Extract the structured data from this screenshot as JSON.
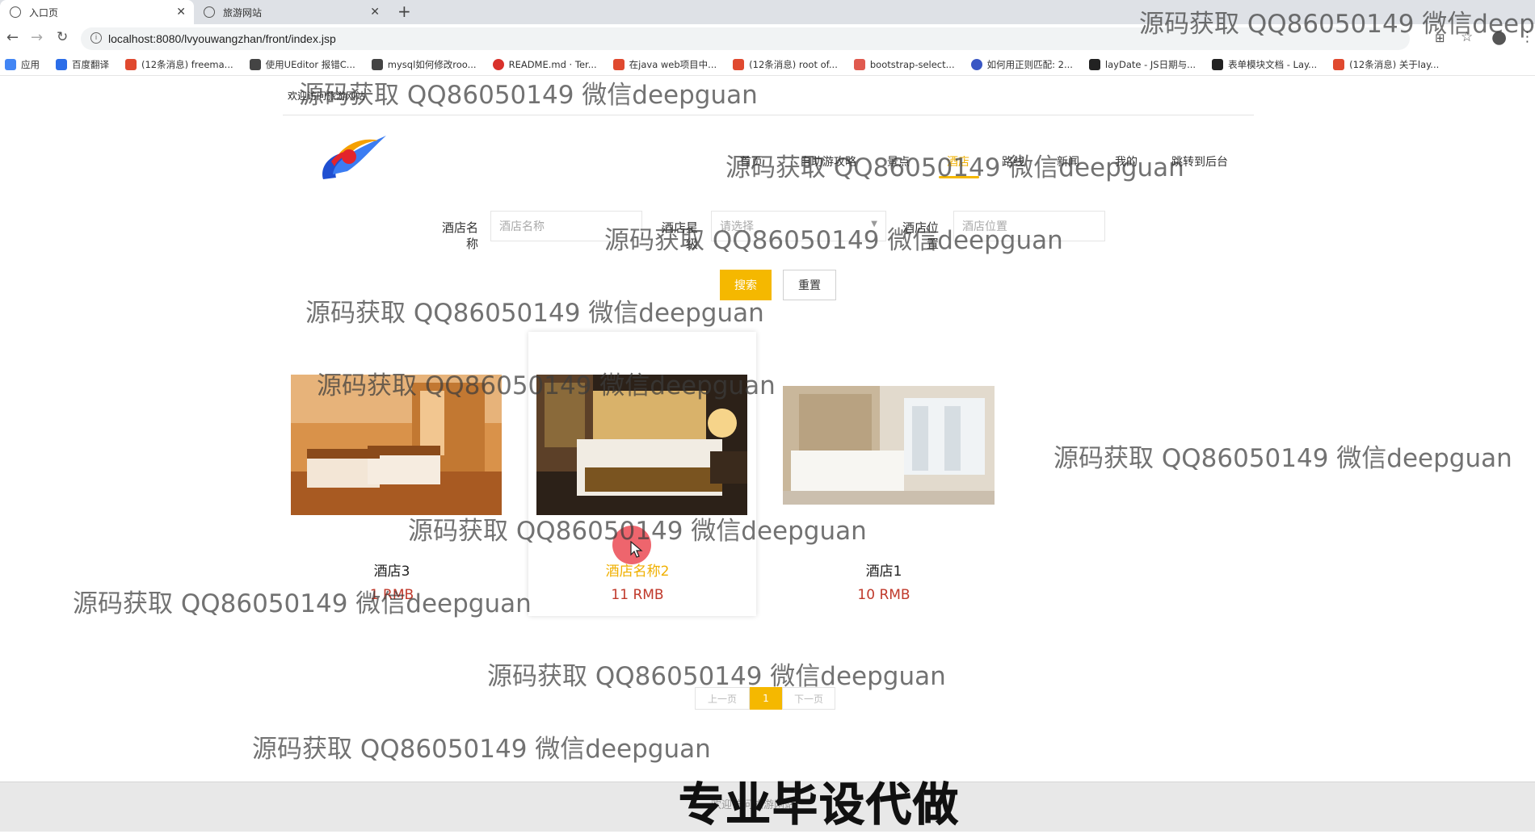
{
  "browser": {
    "tabs": [
      {
        "title": "入口页",
        "active": true
      },
      {
        "title": "旅游网站",
        "active": false
      }
    ],
    "url": "localhost:8080/lvyouwangzhan/front/index.jsp",
    "bookmarks": [
      {
        "label": "应用",
        "color": "#4285f4"
      },
      {
        "label": "百度翻译",
        "color": "#2b6de8"
      },
      {
        "label": "(12条消息) freema...",
        "color": "#e0492f"
      },
      {
        "label": "使用UEditor 报错C...",
        "color": "#444444"
      },
      {
        "label": "mysql如何修改roo...",
        "color": "#444444"
      },
      {
        "label": "README.md · Ter...",
        "color": "#d9312b"
      },
      {
        "label": "在java web项目中...",
        "color": "#e0492f"
      },
      {
        "label": "(12条消息) root of...",
        "color": "#e0492f"
      },
      {
        "label": "bootstrap-select...",
        "color": "#e05a4f"
      },
      {
        "label": "如何用正则匹配: 2...",
        "color": "#3a57c4"
      },
      {
        "label": "layDate - JS日期与...",
        "color": "#222222"
      },
      {
        "label": "表单模块文档 - Lay...",
        "color": "#222222"
      },
      {
        "label": "(12条消息) 关于lay...",
        "color": "#e0492f"
      }
    ]
  },
  "header": {
    "welcome": "欢迎访问旅游网站",
    "nav": [
      {
        "label": "首页",
        "active": false
      },
      {
        "label": "自助游攻略",
        "active": false
      },
      {
        "label": "景点",
        "active": false
      },
      {
        "label": "酒店",
        "active": true
      },
      {
        "label": "路线",
        "active": false
      },
      {
        "label": "新闻",
        "active": false
      },
      {
        "label": "我的",
        "active": false
      },
      {
        "label": "跳转到后台",
        "active": false
      }
    ]
  },
  "search": {
    "name_label": "酒店名称",
    "name_placeholder": "酒店名称",
    "level_label": "酒店星级",
    "level_placeholder": "请选择",
    "location_label": "酒店位置",
    "location_placeholder": "酒店位置",
    "search_button": "搜索",
    "reset_button": "重置"
  },
  "hotels": [
    {
      "name": "酒店3",
      "price": "1 RMB"
    },
    {
      "name": "酒店名称2",
      "price": "11 RMB"
    },
    {
      "name": "酒店1",
      "price": "10 RMB"
    }
  ],
  "pagination": {
    "prev": "上一页",
    "current": "1",
    "next": "下一页"
  },
  "footer": {
    "text": "欢迎访问旅游网站"
  },
  "overlay": {
    "watermark": "源码获取 QQ86050149 微信deepguan",
    "banner": "专业毕设代做"
  },
  "colors": {
    "accent": "#f5b800",
    "price": "#c0392b"
  }
}
